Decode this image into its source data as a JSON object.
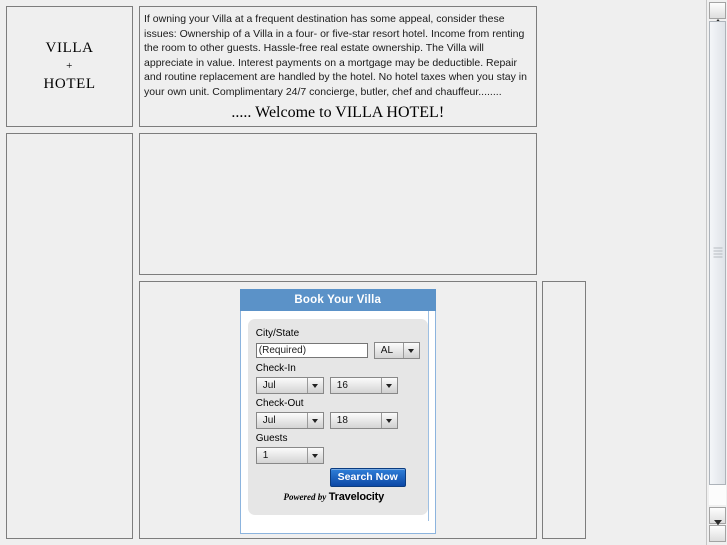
{
  "brand": {
    "line1": "VILLA",
    "plus": "+",
    "line2": "HOTEL"
  },
  "intro": {
    "body": "If owning your Villa at a frequent destination has some appeal, consider these issues: Ownership of a Villa in a four- or five-star resort hotel. Income from renting the room to other guests. Hassle-free real estate ownership. The Villa will appreciate in value. Interest payments on a mortgage may be deductible. Repair and routine replacement are handled by the hotel. No hotel taxes when you stay in your own unit. Complimentary 24/7 concierge, butler, chef and chauffeur........",
    "welcome": "..... Welcome to VILLA HOTEL!"
  },
  "widget": {
    "header_title": "Book Your Villa",
    "city_state_label": "City/State",
    "city_state_value": "(Required)",
    "city_state_placeholder": "(Required)",
    "state_value": "AL",
    "checkin_label": "Check-In",
    "checkin_month": "Jul",
    "checkin_day": "16",
    "checkout_label": "Check-Out",
    "checkout_month": "Jul",
    "checkout_day": "18",
    "guests_label": "Guests",
    "guests_value": "1",
    "search_button": "Search Now",
    "powered_prefix": "Powered by",
    "powered_brand": "Travelocity",
    "header_bg": "#5b92c8",
    "button_bg": "#0b47a6"
  },
  "scrollbar": {
    "up_icon": "triangle-up",
    "down_icon": "triangle-down"
  }
}
